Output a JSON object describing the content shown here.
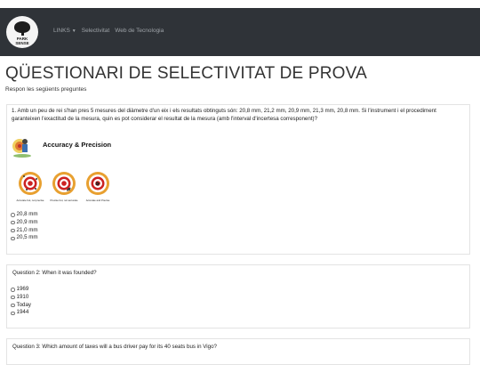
{
  "navbar": {
    "logo_text": "PARK\nSENSE",
    "links": [
      "LINKS",
      "Selectivitat",
      "Web de Tecnologia"
    ]
  },
  "page": {
    "title": "QÜESTIONARI DE SELECTIVITAT DE PROVA",
    "subtitle": "Respon les següents preguntes"
  },
  "questions": [
    {
      "text": "1. Amb un peu de rei s'han pres 5 mesures del diàmetre d'un eix i els resultats obtinguts són: 20,8 mm, 21,2 mm, 20,9 mm, 21,3 mm, 20,8 mm. Si l'instrument i el procediment garanteixen l'exactitud de la mesura, quin es pot considerar el resultat de la mesura (amb l'interval d'incertesa corresponent)?",
      "image": {
        "title": "Accuracy & Precision",
        "captions": [
          "Accurate but, not precise",
          "Precise but, not accurate",
          "Accurate and Precise"
        ]
      },
      "options": [
        "20,8 mm",
        "20,9 mm",
        "21,0 mm",
        "20,5 mm"
      ]
    },
    {
      "text": "Question 2: When it was founded?",
      "options": [
        "1969",
        "1910",
        "Today",
        "1944"
      ]
    },
    {
      "text": "Question 3: Which amount of taxes will a bus driver pay for its 40 seats bus in Vigo?"
    }
  ],
  "colors": {
    "navbar": "#2f3338",
    "target_red": "#cc2222",
    "target_orange": "#e8a030"
  }
}
